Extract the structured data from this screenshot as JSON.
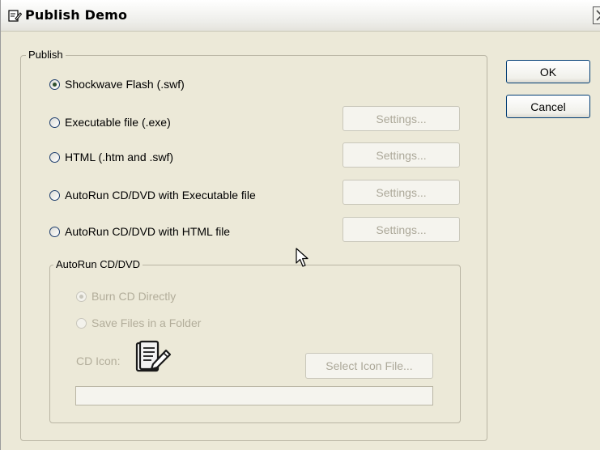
{
  "window": {
    "title": "Publish Demo",
    "title_icon": "publish-icon",
    "close_icon": "close-icon"
  },
  "publish_group": {
    "legend": "Publish",
    "options": [
      {
        "label": "Shockwave Flash (.swf)",
        "checked": true
      },
      {
        "label": "Executable file (.exe)",
        "checked": false
      },
      {
        "label": "HTML (.htm and .swf)",
        "checked": false
      },
      {
        "label": "AutoRun CD/DVD with Executable file",
        "checked": false
      },
      {
        "label": "AutoRun CD/DVD with HTML file",
        "checked": false
      }
    ],
    "settings_label": "Settings..."
  },
  "buttons": {
    "ok": "OK",
    "cancel": "Cancel"
  },
  "autorun_group": {
    "legend": "AutoRun CD/DVD",
    "options": [
      {
        "label": "Burn CD Directly",
        "checked": true
      },
      {
        "label": "Save Files in a Folder",
        "checked": false
      }
    ],
    "cd_icon_label": "CD Icon:",
    "cd_icon": "document-pen-icon",
    "select_icon_label": "Select Icon File...",
    "path_value": ""
  },
  "colors": {
    "dialog_bg": "#ece9d8",
    "disabled_text": "#aca899",
    "button_border": "#003c74"
  }
}
